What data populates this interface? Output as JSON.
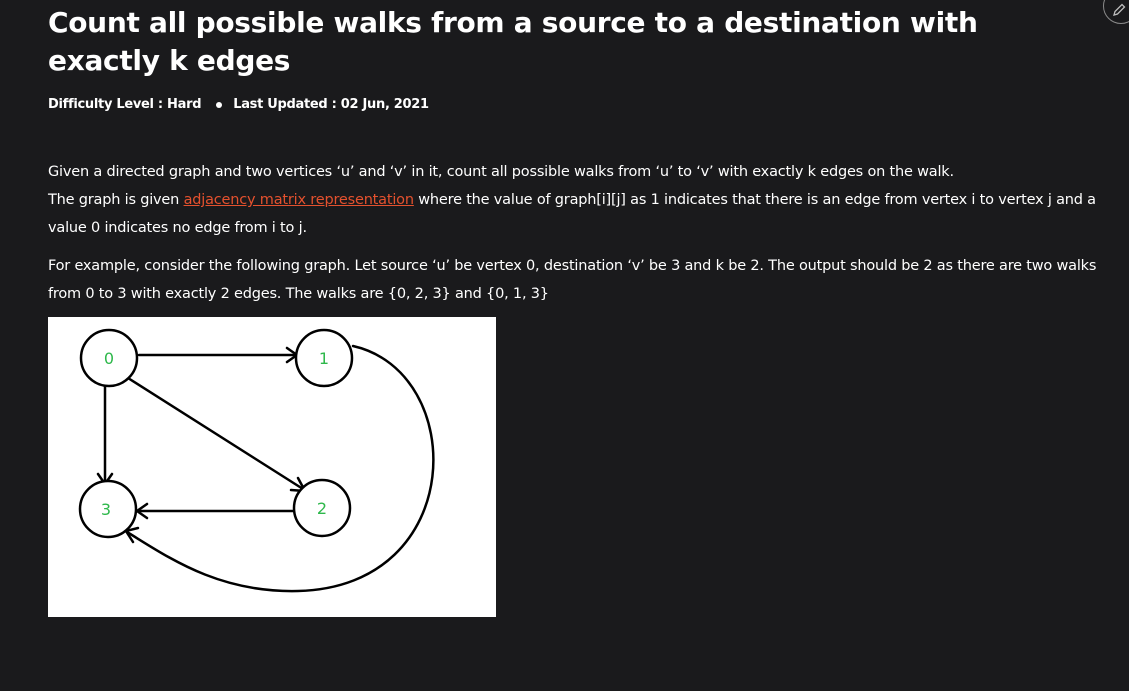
{
  "article": {
    "title": "Count all possible walks from a source to a destination with exactly k edges",
    "difficulty": "Difficulty Level : Hard",
    "last_updated": "Last Updated : 02 Jun, 2021"
  },
  "body": {
    "p1_line1": "Given a directed graph and two vertices ‘u’ and ‘v’ in it, count all possible walks from ‘u’ to ‘v’ with exactly k edges on the walk.",
    "p1_line2_pre": "The graph is given ",
    "p1_link": "adjacency matrix representation",
    "p1_line2_post": " where the value of graph[i][j] as 1 indicates that there is an edge from vertex i to vertex j and a value 0 indicates no edge from i to j.",
    "p2": "For example, consider the following graph. Let source ‘u’ be vertex 0, destination ‘v’ be 3 and k be 2. The output should be 2 as there are two walks from 0 to 3 with exactly 2 edges. The walks are {0, 2, 3} and {0, 1, 3}"
  },
  "graph": {
    "nodes": [
      {
        "id": "0",
        "label": "0"
      },
      {
        "id": "1",
        "label": "1"
      },
      {
        "id": "2",
        "label": "2"
      },
      {
        "id": "3",
        "label": "3"
      }
    ],
    "label_color": "#2eb84b"
  },
  "icons": {
    "corner": "pencil-icon",
    "meta_separator": "bullet-dot-icon"
  },
  "colors": {
    "background": "#1a1a1c",
    "text": "#ffffff",
    "link": "#e4512e"
  }
}
